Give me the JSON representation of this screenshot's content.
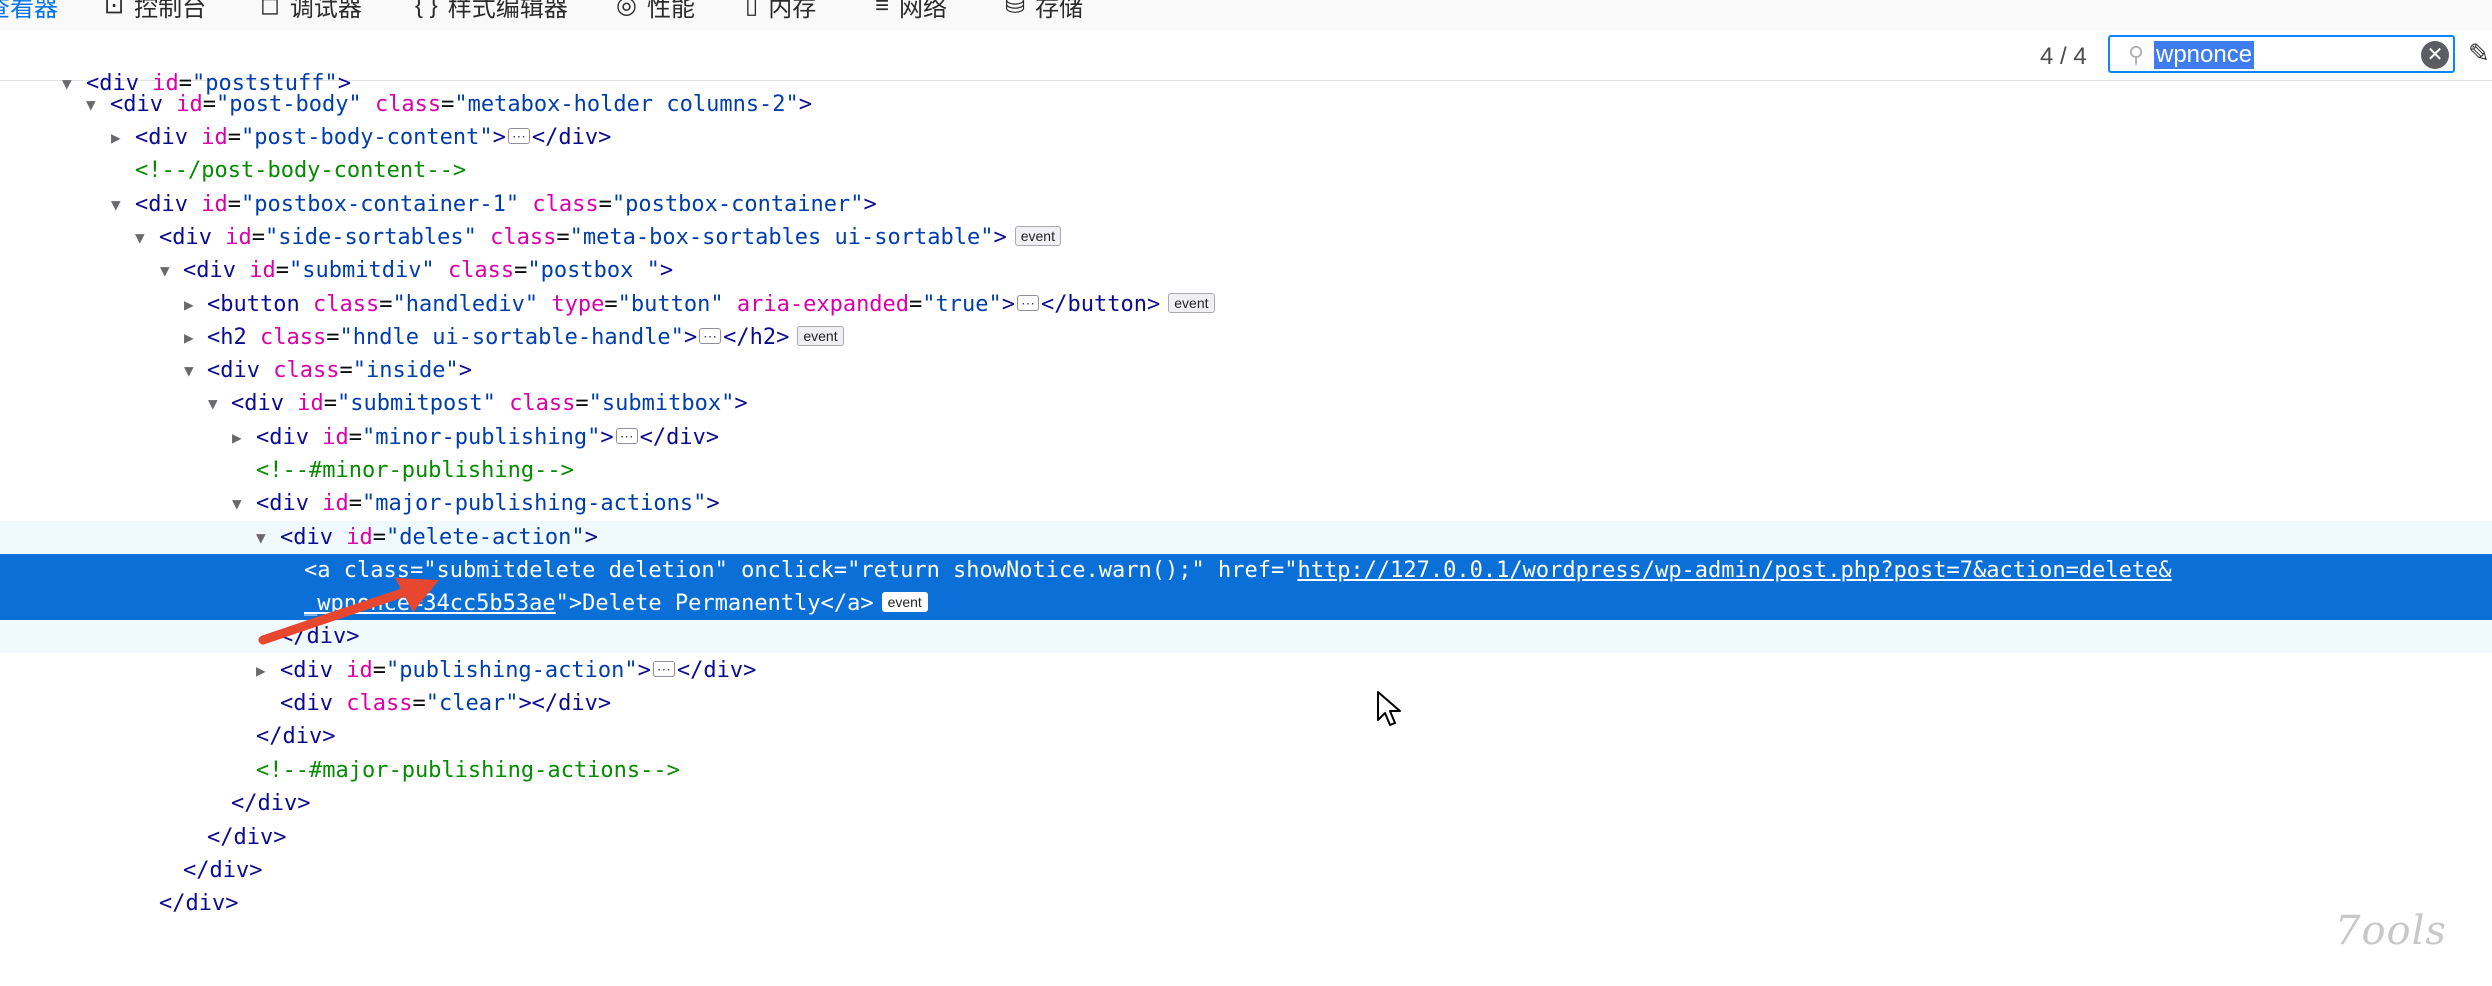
{
  "toolbar": {
    "tabs": [
      {
        "label": "查看器",
        "icon": "inspector-icon"
      },
      {
        "label": "控制台",
        "icon": "console-icon"
      },
      {
        "label": "调试器",
        "icon": "debugger-icon"
      },
      {
        "label": "样式编辑器",
        "icon": "style-editor-icon"
      },
      {
        "label": "性能",
        "icon": "performance-icon"
      },
      {
        "label": "内存",
        "icon": "memory-icon"
      },
      {
        "label": "网络",
        "icon": "network-icon"
      },
      {
        "label": "存储",
        "icon": "storage-icon"
      }
    ]
  },
  "search": {
    "count": "4 / 4",
    "query": "wpnonce"
  },
  "tree": {
    "poststuff": {
      "id_val": "\"poststuff\""
    },
    "post_body": {
      "id_val": "\"post-body\"",
      "class_val": "\"metabox-holder columns-2\""
    },
    "post_body_content": {
      "id_val": "\"post-body-content\""
    },
    "comment_post_body_content": "<!--/post-body-content-->",
    "postbox_container": {
      "id_val": "\"postbox-container-1\"",
      "class_val": "\"postbox-container\""
    },
    "side_sortables": {
      "id_val": "\"side-sortables\"",
      "class_val": "\"meta-box-sortables ui-sortable\""
    },
    "submitdiv": {
      "id_val": "\"submitdiv\"",
      "class_val": "\"postbox \""
    },
    "handlediv": {
      "class_val": "\"handlediv\"",
      "type_val": "\"button\"",
      "aria_val": "\"true\""
    },
    "h2": {
      "class_val": "\"hndle ui-sortable-handle\""
    },
    "inside": {
      "class_val": "\"inside\""
    },
    "submitpost": {
      "id_val": "\"submitpost\"",
      "class_val": "\"submitbox\""
    },
    "minor_publishing": {
      "id_val": "\"minor-publishing\""
    },
    "comment_minor": "<!--#minor-publishing-->",
    "major_publishing": {
      "id_val": "\"major-publishing-actions\""
    },
    "delete_action": {
      "id_val": "\"delete-action\""
    },
    "anchor": {
      "class_val": "\"submitdelete deletion\"",
      "onclick_val": "\"return showNotice.warn();\"",
      "href_part1": "http://127.0.0.1/wordpress/wp-admin/post.php?post=7&action=delete&",
      "href_part2": "_wpnonce=34cc5b53ae",
      "text": "Delete Permanently"
    },
    "publishing_action": {
      "id_val": "\"publishing-action\""
    },
    "clear": {
      "class_val": "\"clear\""
    },
    "comment_major": "<!--#major-publishing-actions-->",
    "badge_label": "event"
  },
  "watermark": "7ools"
}
